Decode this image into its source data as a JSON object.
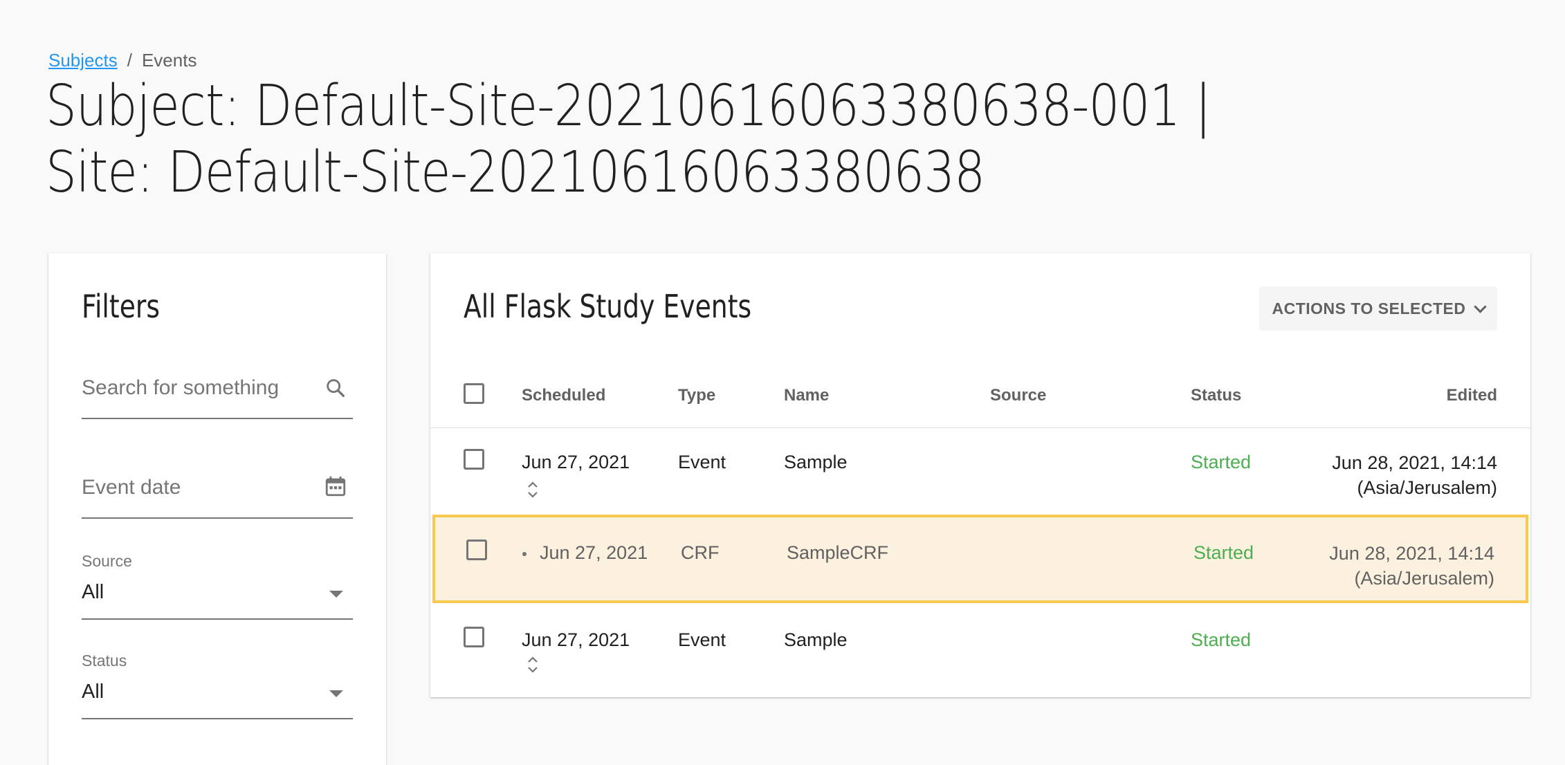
{
  "breadcrumb": {
    "root": "Subjects",
    "separator": "/",
    "current": "Events"
  },
  "page_title": "Subject: Default-Site-20210616063380638-001 | Site: Default-Site-20210616063380638",
  "filters": {
    "title": "Filters",
    "search_placeholder": "Search for something",
    "event_date_placeholder": "Event date",
    "source_label": "Source",
    "source_value": "All",
    "status_label": "Status",
    "status_value": "All"
  },
  "events": {
    "title": "All Flask Study Events",
    "actions_label": "ACTIONS TO SELECTED",
    "columns": {
      "scheduled": "Scheduled",
      "type": "Type",
      "name": "Name",
      "source": "Source",
      "status": "Status",
      "edited": "Edited"
    },
    "rows": [
      {
        "scheduled": "Jun 27, 2021",
        "type": "Event",
        "name": "Sample",
        "source": "",
        "status": "Started",
        "edited_line1": "Jun 28, 2021, 14:14",
        "edited_line2": "(Asia/Jerusalem)"
      },
      {
        "scheduled": "Jun 27, 2021",
        "type": "CRF",
        "name": "SampleCRF",
        "source": "",
        "status": "Started",
        "edited_line1": "Jun 28, 2021, 14:14",
        "edited_line2": "(Asia/Jerusalem)"
      },
      {
        "scheduled": "Jun 27, 2021",
        "type": "Event",
        "name": "Sample",
        "source": "",
        "status": "Started",
        "edited_line1": "",
        "edited_line2": ""
      }
    ]
  },
  "colors": {
    "link": "#2196f3",
    "status_started": "#4caf50",
    "highlight_bg": "#fcf0df",
    "highlight_border": "#f8c94c"
  },
  "icons": {
    "search": "search-icon",
    "calendar": "calendar-icon",
    "sort": "sort-icon",
    "dropdown": "chevron-down-icon"
  }
}
